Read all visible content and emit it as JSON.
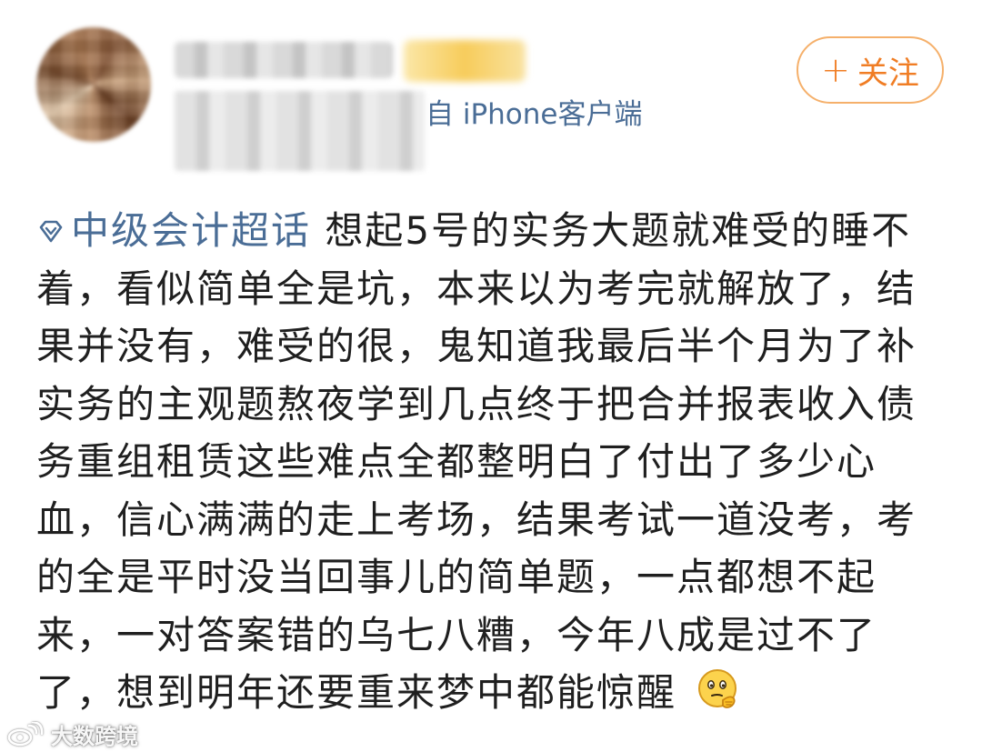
{
  "header": {
    "source_text": "自 iPhone客户端",
    "follow_label": "关注",
    "follow_plus": "+"
  },
  "post": {
    "topic": "中级会计超话",
    "body": "想起5号的实务大题就难受的睡不着，看似简单全是坑，本来以为考完就解放了，结果并没有，难受的很，鬼知道我最后半个月为了补实务的主观题熬夜学到几点终于把合并报表收入债务重组租赁这些难点全都整明白了付出了多少心血，信心满满的走上考场，结果考试一道没考，考的全是平时没当回事儿的简单题，一点都想不起来，一对答案错的乌七八糟，今年八成是过不了了，想到明年还要重来梦中都能惊醒"
  },
  "watermark": {
    "text": "大数跨境"
  },
  "colors": {
    "link": "#4a6d96",
    "follow_orange": "#f07d24",
    "follow_border": "#f5b06b",
    "text": "#1f1f1f"
  },
  "icons": {
    "topic": "supertopic-diamond-icon",
    "emoji": "thinking-face-emoji-icon",
    "follow": "plus-icon",
    "watermark_logo": "weibo-logo-icon"
  }
}
